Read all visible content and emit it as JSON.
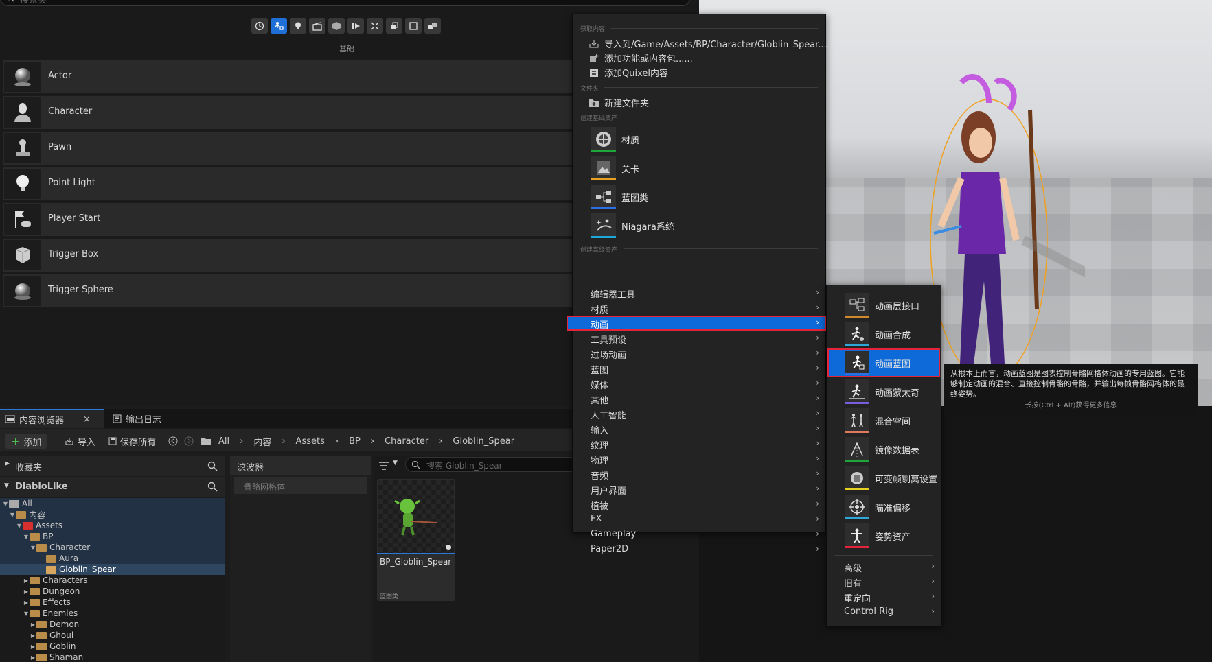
{
  "place_actors": {
    "search_placeholder": "搜索类",
    "category_label": "基础",
    "actors": [
      {
        "label": "Actor",
        "icon": "sphere-icon"
      },
      {
        "label": "Character",
        "icon": "character-icon"
      },
      {
        "label": "Pawn",
        "icon": "pawn-icon"
      },
      {
        "label": "Point Light",
        "icon": "lightbulb-icon"
      },
      {
        "label": "Player Start",
        "icon": "player-start-icon"
      },
      {
        "label": "Trigger Box",
        "icon": "trigger-box-icon"
      },
      {
        "label": "Trigger Sphere",
        "icon": "trigger-sphere-icon"
      }
    ]
  },
  "content_browser": {
    "tab_label": "内容浏览器",
    "tab_close": "×",
    "output_log_label": "输出日志",
    "add_label": "添加",
    "import_label": "导入",
    "save_all_label": "保存所有",
    "breadcrumb": [
      "All",
      "内容",
      "Assets",
      "BP",
      "Character",
      "Globlin_Spear"
    ],
    "favorites_label": "收藏夹",
    "project_label": "DiabloLike",
    "tree": [
      {
        "label": "All",
        "depth": 0
      },
      {
        "label": "内容",
        "depth": 1
      },
      {
        "label": "Assets",
        "depth": 2
      },
      {
        "label": "BP",
        "depth": 3
      },
      {
        "label": "Character",
        "depth": 4
      },
      {
        "label": "Aura",
        "depth": 5
      },
      {
        "label": "Globlin_Spear",
        "depth": 5
      },
      {
        "label": "Characters",
        "depth": 3
      },
      {
        "label": "Dungeon",
        "depth": 3
      },
      {
        "label": "Effects",
        "depth": 3
      },
      {
        "label": "Enemies",
        "depth": 3
      },
      {
        "label": "Demon",
        "depth": 4
      },
      {
        "label": "Ghoul",
        "depth": 4
      },
      {
        "label": "Goblin",
        "depth": 4
      },
      {
        "label": "Shaman",
        "depth": 4
      }
    ],
    "filters_label": "滤波器",
    "filter_item": "骨骼网格体",
    "asset_search_placeholder": "搜索 Globlin_Spear",
    "asset_name": "BP_Globlin_Spear",
    "asset_type": "蓝图类"
  },
  "context_menu": {
    "sec_get_content": "获取内容",
    "import_to": "导入到/Game/Assets/BP/Character/Globlin_Spear......",
    "add_feature": "添加功能或内容包......",
    "add_quixel": "添加Quixel内容",
    "sec_folder": "文件夹",
    "new_folder": "新建文件夹",
    "sec_basic_assets": "创建基础资产",
    "basic_assets": [
      {
        "label": "材质",
        "color": "#1fa63b"
      },
      {
        "label": "关卡",
        "color": "#e8a020"
      },
      {
        "label": "蓝图类",
        "color": "#2b6fe0"
      },
      {
        "label": "Niagara系统",
        "color": "#1ea7d8"
      }
    ],
    "sec_advanced_assets": "创建高级资产",
    "advanced": [
      "编辑器工具",
      "材质",
      "动画",
      "工具预设",
      "过场动画",
      "蓝图",
      "媒体",
      "其他",
      "人工智能",
      "输入",
      "纹理",
      "物理",
      "音频",
      "用户界面",
      "植被",
      "FX",
      "Gameplay",
      "Paper2D"
    ],
    "chevron": "›"
  },
  "anim_submenu": {
    "items": [
      {
        "label": "动画层接口",
        "color": "#d08a2c"
      },
      {
        "label": "动画合成",
        "color": "#2fa8d8"
      },
      {
        "label": "动画蓝图",
        "color": "#2b6fe0"
      },
      {
        "label": "动画蒙太奇",
        "color": "#7a5ce0"
      },
      {
        "label": "混合空间",
        "color": "#e07a5f"
      },
      {
        "label": "镜像数据表",
        "color": "#1fa63b"
      },
      {
        "label": "可变帧剔离设置",
        "color": "#e8d020"
      },
      {
        "label": "瞄准偏移",
        "color": "#2fa8d8"
      },
      {
        "label": "姿势资产",
        "color": "#e5233a"
      }
    ],
    "more": [
      "高级",
      "旧有",
      "重定向",
      "Control Rig"
    ]
  },
  "tooltip": {
    "text": "从根本上而言，动画蓝图是图表控制骨骼网格体动画的专用蓝图。它能够制定动画的混合、直接控制骨骼的骨骼，并输出每帧骨骼网格体的最终姿势。",
    "hint": "长按(Ctrl + Alt)获得更多信息"
  }
}
